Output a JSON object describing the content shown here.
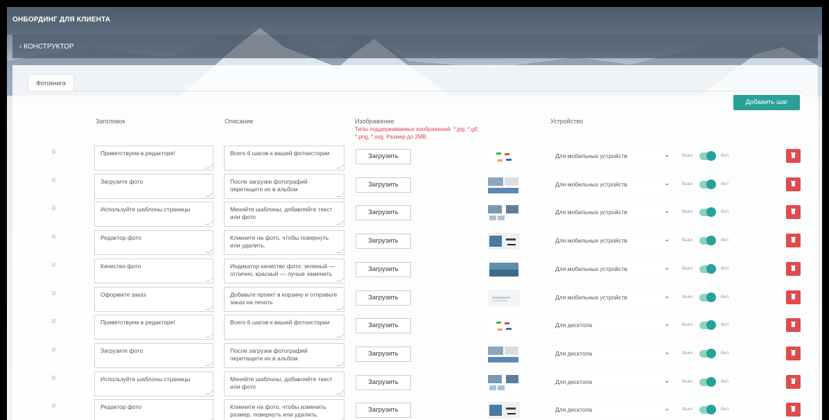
{
  "header": {
    "title": "ОНБОРДИНГ ДЛЯ КЛИЕНТА"
  },
  "breadcrumb": {
    "back_label": "‹ КОНСТРУКТОР"
  },
  "tabs": [
    {
      "label": "Фотокнига"
    }
  ],
  "toolbar": {
    "add_step_label": "Добавить шаг"
  },
  "columns": {
    "title": "Заголовок",
    "description": "Описание",
    "image": "Изображение",
    "image_hint": "Типы поддерживаемых изображений: *.jpg, *.gif, *.png, *.svg. Размер до 2MB.",
    "device": "Устройство"
  },
  "toggle_labels": {
    "off": "Выкл",
    "on": "Вкл"
  },
  "upload_label": "Загрузить",
  "rows": [
    {
      "title": "Приветствуем в редакторе!",
      "description": "Всего 6 шагов к вашей фотоистории",
      "device": "Для мобильных устройств",
      "enabled": true
    },
    {
      "title": "Загрузите фото",
      "description": "После загрузки фотографий перетащите их в альбом",
      "device": "Для мобильных устройств",
      "enabled": true
    },
    {
      "title": "Используйте шаблоны страницы",
      "description": "Меняйте шаблоны, добавляйте текст или фото",
      "device": "Для мобильных устройств",
      "enabled": true
    },
    {
      "title": "Редактор фото",
      "description": "Кликните на фото, чтобы повернуть или удалить.",
      "device": "Для мобильных устройств",
      "enabled": true
    },
    {
      "title": "Качество фото",
      "description": "Индикатор качество фото: зеленый — отлично, красный — лучше заменить",
      "device": "Для мобильных устройств",
      "enabled": true
    },
    {
      "title": "Оформите заказ",
      "description": "Добавьте проект в корзину и отправьте заказ на печать",
      "device": "Для мобильных устройств",
      "enabled": true
    },
    {
      "title": "Приветствуем в редакторе!",
      "description": "Всего 6 шагов к вашей фотоистории",
      "device": "Для десктопа",
      "enabled": true
    },
    {
      "title": "Загрузите фото",
      "description": "После загрузки фотографий перетащите их в альбом",
      "device": "Для десктопа",
      "enabled": true
    },
    {
      "title": "Используйте шаблоны страницы",
      "description": "Меняйте шаблоны, добавляйте текст или фото",
      "device": "Для десктопа",
      "enabled": true
    },
    {
      "title": "Редактор фото",
      "description": "Кликните на фото, чтобы изменить размер, повернуть или удалить.",
      "device": "Для десктопа",
      "enabled": true
    }
  ],
  "colors": {
    "accent": "#2aa197",
    "danger": "#e04b4b",
    "hint": "#e0415b"
  }
}
